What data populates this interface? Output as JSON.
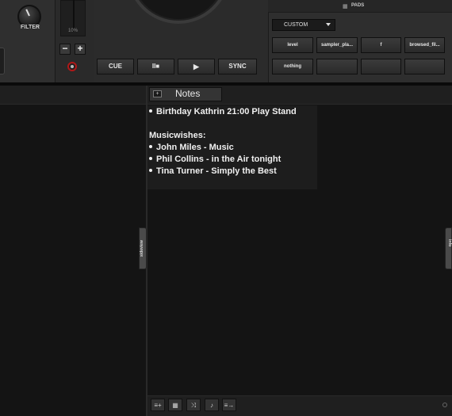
{
  "deck": {
    "filter_label": "FILTER",
    "pitch_percent": "10%",
    "pitch_minus": "−",
    "pitch_plus": "+",
    "transport": {
      "cue": "CUE",
      "pause": "II■",
      "play": "▶",
      "sync": "SYNC"
    }
  },
  "pads": {
    "title": "PADS",
    "mode": "CUSTOM",
    "buttons": [
      "level",
      "sampler_pla...",
      "f",
      "browsed_fil...",
      "nothing",
      "",
      "",
      ""
    ]
  },
  "browser": {
    "notes_tab_label": "Notes",
    "notes_lines": [
      {
        "bullet": true,
        "text": "Birthday Kathrin 21:00 Play Stand"
      },
      {
        "bullet": false,
        "text": ""
      },
      {
        "bullet": false,
        "text": "Musicwishes:"
      },
      {
        "bullet": true,
        "text": "John Miles - Music"
      },
      {
        "bullet": true,
        "text": "Phil Collins - in the Air tonight"
      },
      {
        "bullet": true,
        "text": "Tina Turner - Simply the Best"
      }
    ],
    "sideview_label": "sideview",
    "info_label": "info",
    "bottom_buttons": [
      {
        "name": "add-to-list-icon",
        "glyph": "≡+"
      },
      {
        "name": "grid-view-icon",
        "glyph": "▦"
      },
      {
        "name": "shuffle-icon",
        "glyph": "⤨"
      },
      {
        "name": "microphone-icon",
        "glyph": "♪"
      },
      {
        "name": "automix-list-icon",
        "glyph": "≡→"
      }
    ]
  },
  "colors": {
    "record_ring": "#b01818",
    "background": "#141414"
  }
}
